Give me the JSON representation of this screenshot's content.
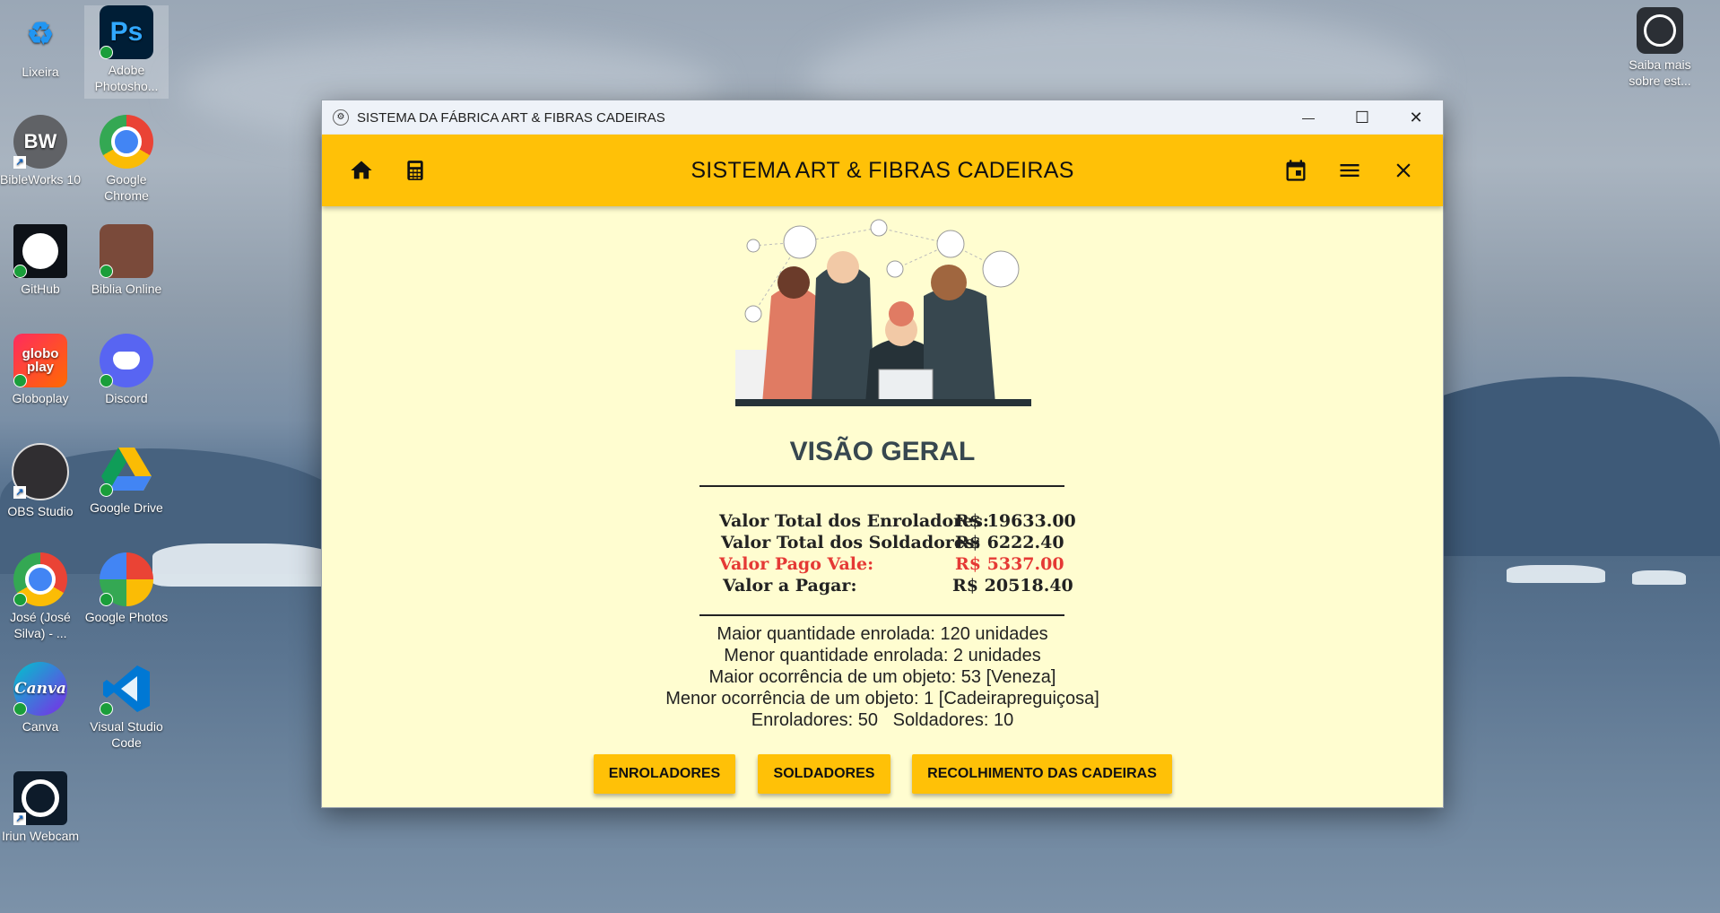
{
  "desktop": {
    "icons": [
      {
        "label": "Lixeira"
      },
      {
        "label": "Adobe Photosho..."
      },
      {
        "label": "BibleWorks 10"
      },
      {
        "label": "Google Chrome"
      },
      {
        "label": "GitHub"
      },
      {
        "label": "Biblia Online"
      },
      {
        "label": "Globoplay"
      },
      {
        "label": "Discord"
      },
      {
        "label": "OBS Studio"
      },
      {
        "label": "Google Drive"
      },
      {
        "label": "José (José Silva) - ..."
      },
      {
        "label": "Google Photos"
      },
      {
        "label": "Canva"
      },
      {
        "label": "Visual Studio Code"
      },
      {
        "label": "Iriun Webcam"
      },
      {
        "label": "Saiba mais sobre est..."
      }
    ],
    "icon_glyphs": {
      "ps": "Ps",
      "bw": "BW",
      "globo": "globo play",
      "canva": "Canva"
    }
  },
  "window": {
    "title": "SISTEMA DA FÁBRICA ART & FIBRAS CADEIRAS",
    "controls": {
      "minimize": "—",
      "maximize": "☐",
      "close": "✕"
    }
  },
  "appbar": {
    "title": "SISTEMA ART & FIBRAS CADEIRAS",
    "icons": [
      "home-icon",
      "calculator-icon",
      "calendar-icon",
      "menu-icon",
      "close-icon"
    ]
  },
  "overview": {
    "heading": "VISÃO GERAL",
    "values": [
      {
        "label": "Valor Total dos Enroladores:",
        "value": "R$ 19633.00"
      },
      {
        "label": "Valor Total dos Soldadores:",
        "value": "R$ 6222.40"
      },
      {
        "label": "Valor Pago Vale:",
        "value": "R$ 5337.00"
      },
      {
        "label": "Valor a Pagar:",
        "value": "R$ 20518.40"
      }
    ],
    "stats": [
      "Maior quantidade enrolada: 120 unidades",
      "Menor quantidade enrolada: 2 unidades",
      "Maior ocorrência de um objeto: 53 [Veneza]",
      "Menor ocorrência de um objeto: 1 [Cadeirapreguiçosa]",
      "Enroladores: 50   Soldadores: 10"
    ]
  },
  "buttons": {
    "enroladores": "ENROLADORES",
    "soldadores": "SOLDADORES",
    "recolhimento": "RECOLHIMENTO DAS CADEIRAS"
  },
  "colors": {
    "accent": "#ffc107",
    "background": "#fffdd0",
    "heading": "#37474f",
    "alert": "#e53935"
  }
}
